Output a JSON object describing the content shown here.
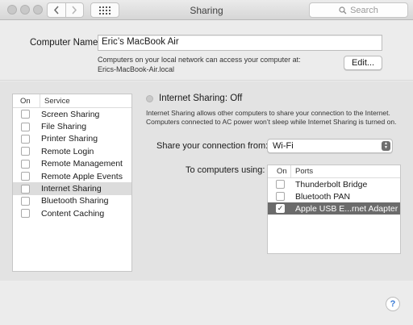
{
  "window": {
    "title": "Sharing",
    "search_placeholder": "Search"
  },
  "computer": {
    "label": "Computer Name:",
    "name": "Eric’s MacBook Air",
    "description_line1": "Computers on your local network can access your computer at:",
    "description_line2": "Erics-MacBook-Air.local",
    "edit_label": "Edit..."
  },
  "services": {
    "header_on": "On",
    "header_service": "Service",
    "items": [
      {
        "label": "Screen Sharing",
        "on": false
      },
      {
        "label": "File Sharing",
        "on": false
      },
      {
        "label": "Printer Sharing",
        "on": false
      },
      {
        "label": "Remote Login",
        "on": false
      },
      {
        "label": "Remote Management",
        "on": false
      },
      {
        "label": "Remote Apple Events",
        "on": false
      },
      {
        "label": "Internet Sharing",
        "on": false,
        "selected": true
      },
      {
        "label": "Bluetooth Sharing",
        "on": false
      },
      {
        "label": "Content Caching",
        "on": false
      }
    ]
  },
  "internet_sharing": {
    "title": "Internet Sharing: Off",
    "description": "Internet Sharing allows other computers to share your connection to the Internet. Computers connected to AC power won’t sleep while Internet Sharing is turned on.",
    "share_from_label": "Share your connection from:",
    "share_from_value": "Wi-Fi",
    "to_label": "To computers using:",
    "ports_header_on": "On",
    "ports_header_ports": "Ports",
    "ports": [
      {
        "label": "Thunderbolt Bridge",
        "on": false
      },
      {
        "label": "Bluetooth PAN",
        "on": false
      },
      {
        "label": "Apple USB E...rnet Adapter",
        "on": true,
        "selected": true
      }
    ]
  },
  "help": {
    "label": "?"
  }
}
